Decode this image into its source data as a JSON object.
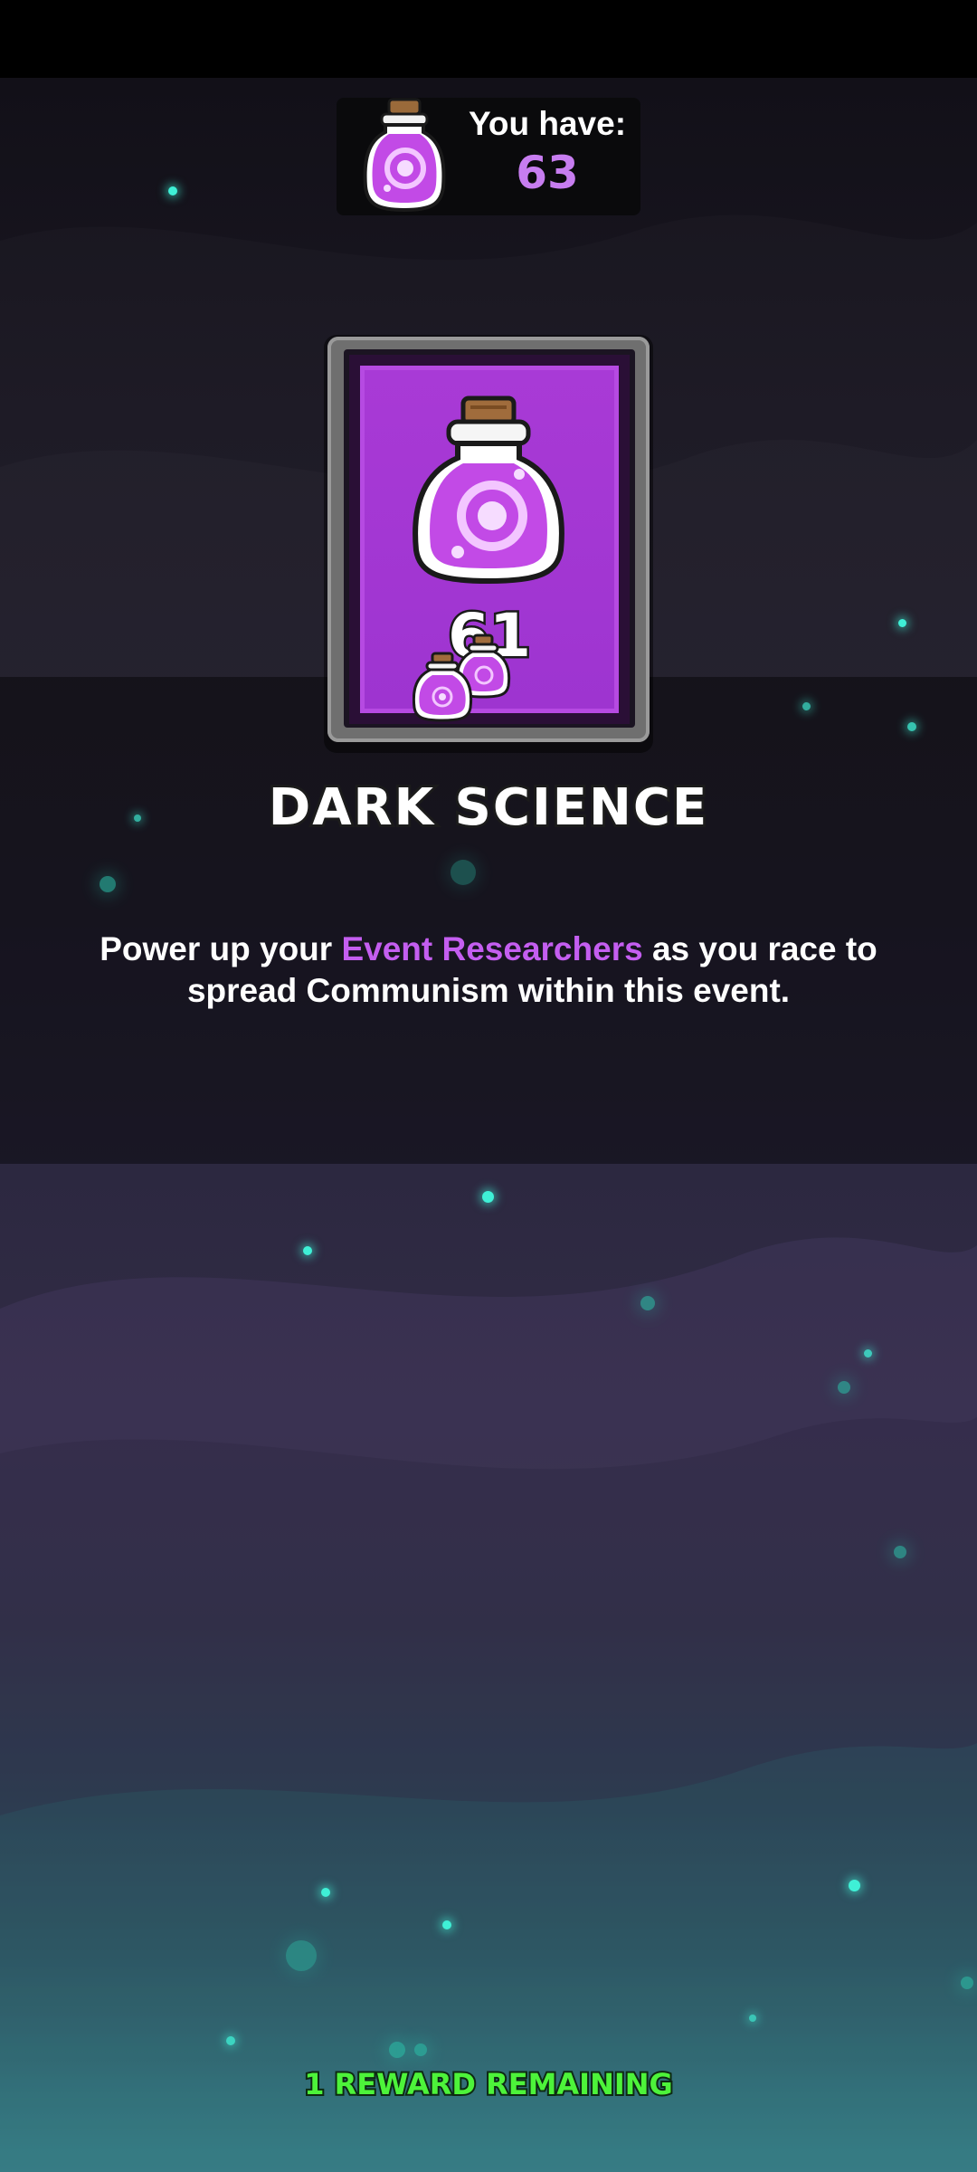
{
  "currency": {
    "label": "You have:",
    "amount": "63",
    "icon": "potion-icon"
  },
  "card": {
    "count": "61",
    "icon": "dark-science-potion-icon",
    "badge_icon": "small-potions-icon"
  },
  "item": {
    "title": "DARK SCIENCE",
    "description_before": "Power up your ",
    "description_highlight": "Event Researchers",
    "description_after": " as you race to spread Communism within this event."
  },
  "footer": {
    "rewards_remaining": "1 REWARD REMAINING"
  },
  "colors": {
    "accent_purple": "#c45ef0",
    "card_purple": "#a93ad6",
    "reward_green": "#4df33a",
    "particle_teal": "#3ff0d6"
  }
}
